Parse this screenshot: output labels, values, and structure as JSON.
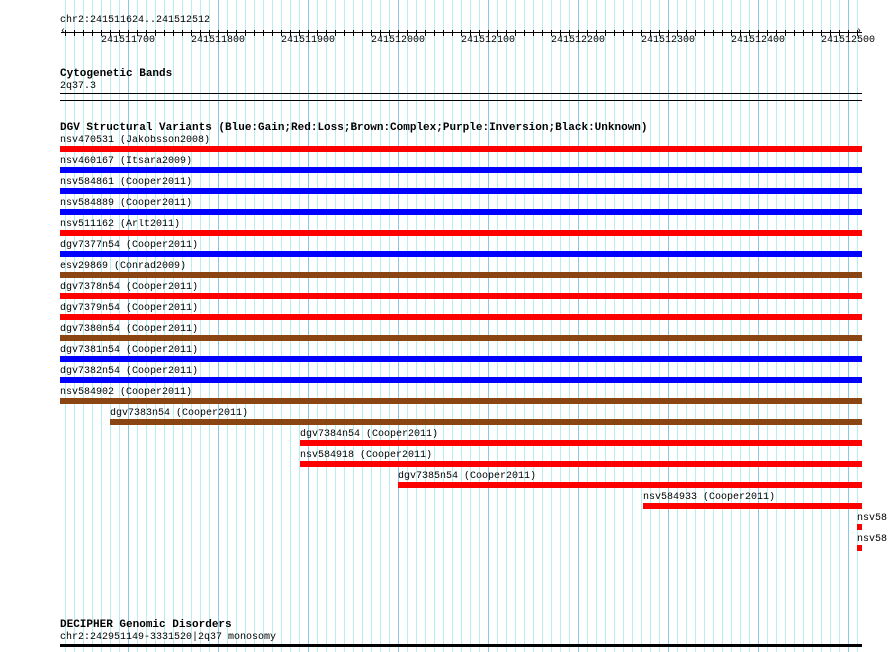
{
  "ruler": {
    "location": "chr2:241511624..241512512",
    "start": 241511624,
    "end": 241512512,
    "tick_labels": [
      "241511700",
      "241511800",
      "241511900",
      "241512000",
      "241512100",
      "241512200",
      "241512300",
      "241512400",
      "241512500"
    ]
  },
  "cytoband": {
    "title": "Cytogenetic Bands",
    "band": "2q37.3"
  },
  "dgv": {
    "title": "DGV Structural Variants (Blue:Gain;Red:Loss;Brown:Complex;Purple:Inversion;Black:Unknown)",
    "colors": {
      "gain": "#0000ff",
      "loss": "#ff0000",
      "complex": "#8b4513"
    },
    "variants": [
      {
        "label": "nsv470531 (Jakobsson2008)",
        "type": "loss",
        "start": 241511624
      },
      {
        "label": "nsv460167 (Itsara2009)",
        "type": "gain",
        "start": 241511624
      },
      {
        "label": "nsv584861 (Cooper2011)",
        "type": "gain",
        "start": 241511624
      },
      {
        "label": "nsv584889 (Cooper2011)",
        "type": "gain",
        "start": 241511624
      },
      {
        "label": "nsv511162 (Arlt2011)",
        "type": "loss",
        "start": 241511624
      },
      {
        "label": "dgv7377n54 (Cooper2011)",
        "type": "gain",
        "start": 241511624
      },
      {
        "label": "esv29869 (Conrad2009)",
        "type": "complex",
        "start": 241511624
      },
      {
        "label": "dgv7378n54 (Cooper2011)",
        "type": "loss",
        "start": 241511624
      },
      {
        "label": "dgv7379n54 (Cooper2011)",
        "type": "loss",
        "start": 241511624
      },
      {
        "label": "dgv7380n54 (Cooper2011)",
        "type": "complex",
        "start": 241511624
      },
      {
        "label": "dgv7381n54 (Cooper2011)",
        "type": "gain",
        "start": 241511624
      },
      {
        "label": "dgv7382n54 (Cooper2011)",
        "type": "gain",
        "start": 241511624
      },
      {
        "label": "nsv584902 (Cooper2011)",
        "type": "complex",
        "start": 241511624
      },
      {
        "label": "dgv7383n54 (Cooper2011)",
        "type": "complex",
        "start": 241511680
      },
      {
        "label": "dgv7384n54 (Cooper2011)",
        "type": "loss",
        "start": 241511891
      },
      {
        "label": "nsv584918 (Cooper2011)",
        "type": "loss",
        "start": 241511891
      },
      {
        "label": "dgv7385n54 (Cooper2011)",
        "type": "loss",
        "start": 241512000
      },
      {
        "label": "nsv584933 (Cooper2011)",
        "type": "loss",
        "start": 241512272
      },
      {
        "label": "nsv58",
        "type": "loss",
        "start": 241512510
      },
      {
        "label": "nsv58",
        "type": "loss",
        "start": 241512510
      }
    ]
  },
  "decipher": {
    "title": "DECIPHER Genomic Disorders",
    "item": "chr2:242951149-3331520|2q37 monosomy"
  }
}
